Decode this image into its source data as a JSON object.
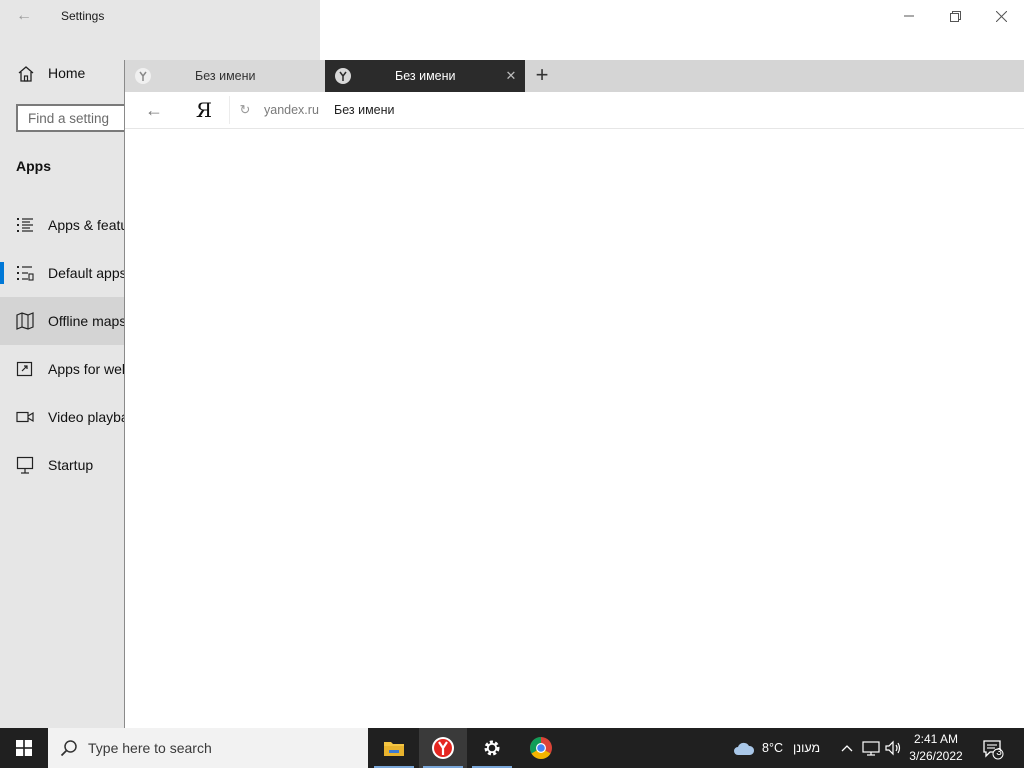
{
  "settings": {
    "title": "Settings",
    "home_label": "Home",
    "search_placeholder": "Find a setting",
    "section_title": "Apps",
    "nav_items": [
      {
        "label": "Apps & features",
        "icon": "list-icon"
      },
      {
        "label": "Default apps",
        "icon": "default-apps-icon"
      },
      {
        "label": "Offline maps",
        "icon": "map-icon"
      },
      {
        "label": "Apps for websites",
        "icon": "link-window-icon"
      },
      {
        "label": "Video playback",
        "icon": "video-icon"
      },
      {
        "label": "Startup",
        "icon": "startup-icon"
      }
    ],
    "selected_item": "Default apps",
    "hovered_item": "Offline maps"
  },
  "browser": {
    "tabs": [
      {
        "title": "Без имени",
        "active": false
      },
      {
        "title": "Без имени",
        "active": true
      }
    ],
    "address_host": "yandex.ru",
    "address_title": "Без имени",
    "yandex_glyph": "Я"
  },
  "taskbar": {
    "search_placeholder": "Type here to search",
    "pinned_apps": [
      "file-explorer-icon",
      "yandex-browser-icon",
      "settings-gear-icon",
      "chrome-icon"
    ],
    "weather_temp": "8°C",
    "weather_desc": "מעונן",
    "time": "2:41 AM",
    "date": "3/26/2022",
    "notification_count": "3"
  },
  "colors": {
    "accent": "#0078d7",
    "sidebar_bg": "#e6e6e6",
    "active_tab_bg": "#2b2b2b",
    "taskbar_bg": "#202020"
  }
}
